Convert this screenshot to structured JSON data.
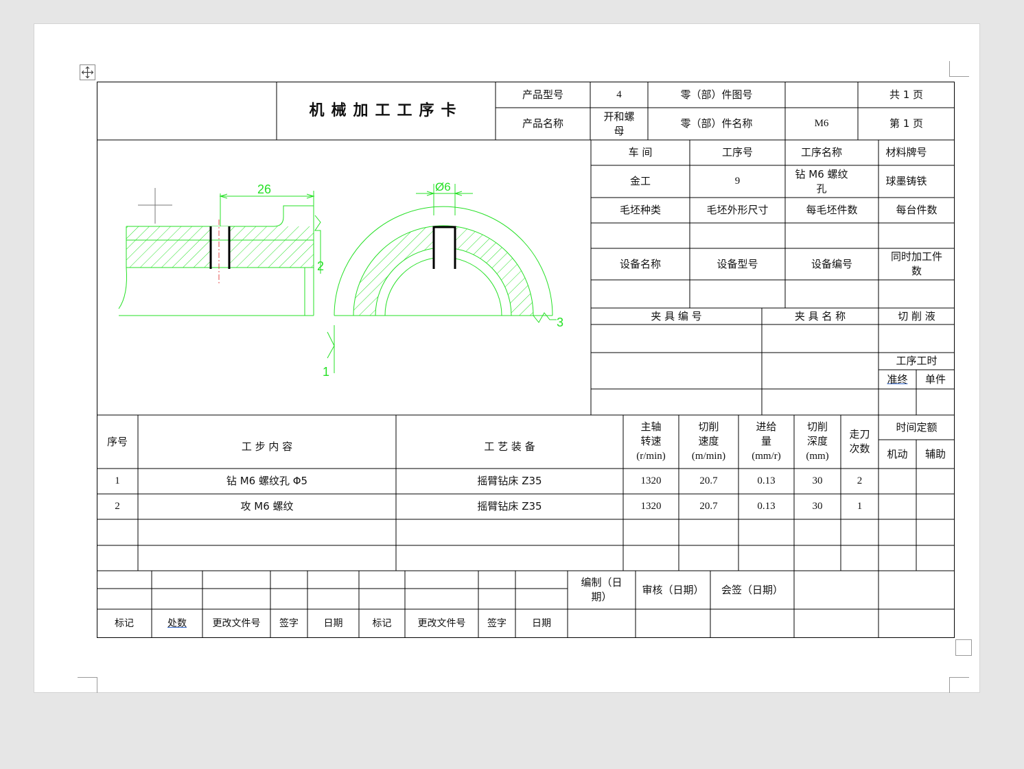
{
  "title": "机械加工工序卡",
  "header": {
    "product_model_label": "产品型号",
    "product_model": "4",
    "part_drawing_no_label": "零（部）件图号",
    "part_drawing_no": "",
    "total_pages": "共 1 页",
    "product_name_label": "产品名称",
    "product_name": "开和螺\n母",
    "part_name_label": "零（部）件名称",
    "part_name": "M6",
    "page_no": "第  1  页"
  },
  "info": {
    "workshop_label": "车        间",
    "op_no_label": "工序号",
    "op_name_label": "工序名称",
    "material_label": "材料牌号",
    "workshop": "金工",
    "op_no": "9",
    "op_name": "钻 M6 螺纹\n孔",
    "material": "球墨铸铁",
    "blank_type_label": "毛坯种类",
    "blank_size_label": "毛坯外形尺寸",
    "pieces_per_blank_label": "每毛坯件数",
    "pieces_per_unit_label": "每台件数",
    "equip_name_label": "设备名称",
    "equip_model_label": "设备型号",
    "equip_no_label": "设备编号",
    "simul_label": "同时加工件\n数",
    "fixture_no_label": "夹    具    编    号",
    "fixture_name_label": "夹    具    名    称",
    "coolant_label": "切 削 液",
    "op_time_label": "工序工时",
    "prep_label": "准终",
    "unit_label": "单件"
  },
  "drawing": {
    "dim_26": "26",
    "dim_d6": "Ø6",
    "roughness_2": "2",
    "roughness_3": "3",
    "roughness_1": "1"
  },
  "steps_header": {
    "seq": "序号",
    "content": "工      步      内      容",
    "equipment": "工      艺      装      备",
    "spindle": "主轴\n转速\n(r/min)",
    "speed": "切削\n速度\n(m/min)",
    "feed": "进给\n量\n(mm/r)",
    "depth": "切削\n深度\n(mm)",
    "passes": "走刀\n次数",
    "time_quota": "时间定额",
    "machine": "机动",
    "aux": "辅助"
  },
  "steps": [
    {
      "seq": "1",
      "content": "钻 M6 螺纹孔 Φ5",
      "equipment": "摇臂钻床 Z35",
      "spindle": "1320",
      "speed": "20.7",
      "feed": "0.13",
      "depth": "30",
      "passes": "2",
      "machine": "",
      "aux": ""
    },
    {
      "seq": "2",
      "content": "攻 M6 螺纹",
      "equipment": "摇臂钻床 Z35",
      "spindle": "1320",
      "speed": "20.7",
      "feed": "0.13",
      "depth": "30",
      "passes": "1",
      "machine": "",
      "aux": ""
    }
  ],
  "footer": {
    "mark": "标记",
    "count": "处数",
    "change_doc": "更改文件号",
    "sign": "签字",
    "date": "日期",
    "mark2": "标记",
    "change_doc2": "更改文件号",
    "sign2": "签字",
    "date2": "日期",
    "compile": "编制（日\n期）",
    "review": "审核（日期）",
    "countersign": "会签（日期）"
  }
}
